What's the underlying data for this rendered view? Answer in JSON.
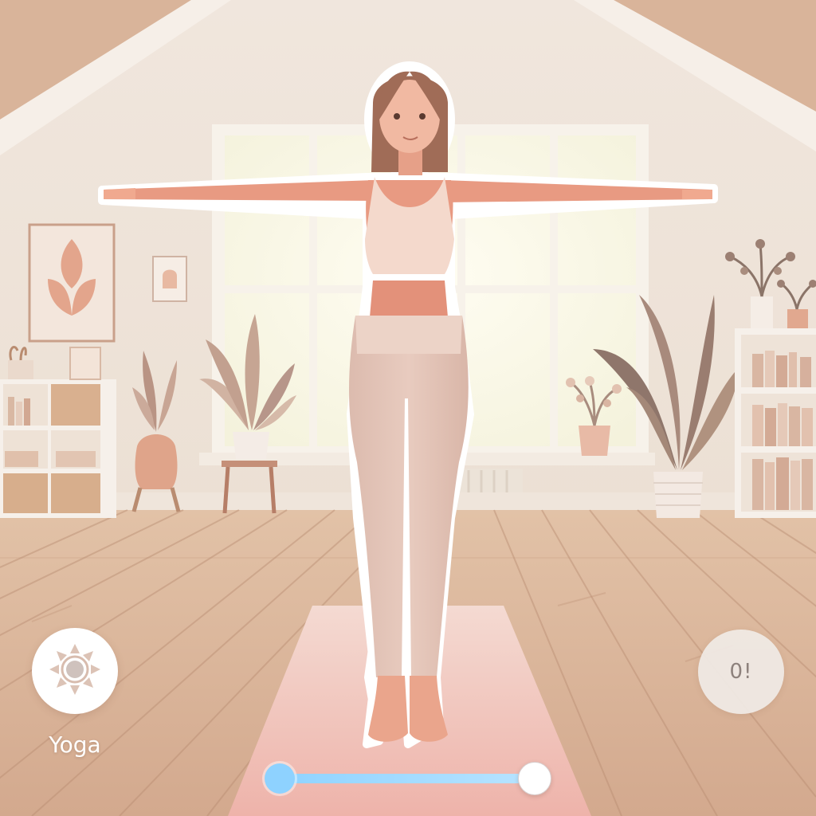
{
  "app": {
    "label": "Yoga",
    "icon": "sun-icon"
  },
  "counter": {
    "text": "0!"
  },
  "progress": {
    "value_fraction": 1.0
  },
  "colors": {
    "wall": "#efe6dc",
    "floor": "#d9b79d",
    "mat": "#f2c7bd",
    "accent_progress": "#8ed2ff",
    "skin": "#e79f86",
    "outfit": "#e6c4b6"
  }
}
